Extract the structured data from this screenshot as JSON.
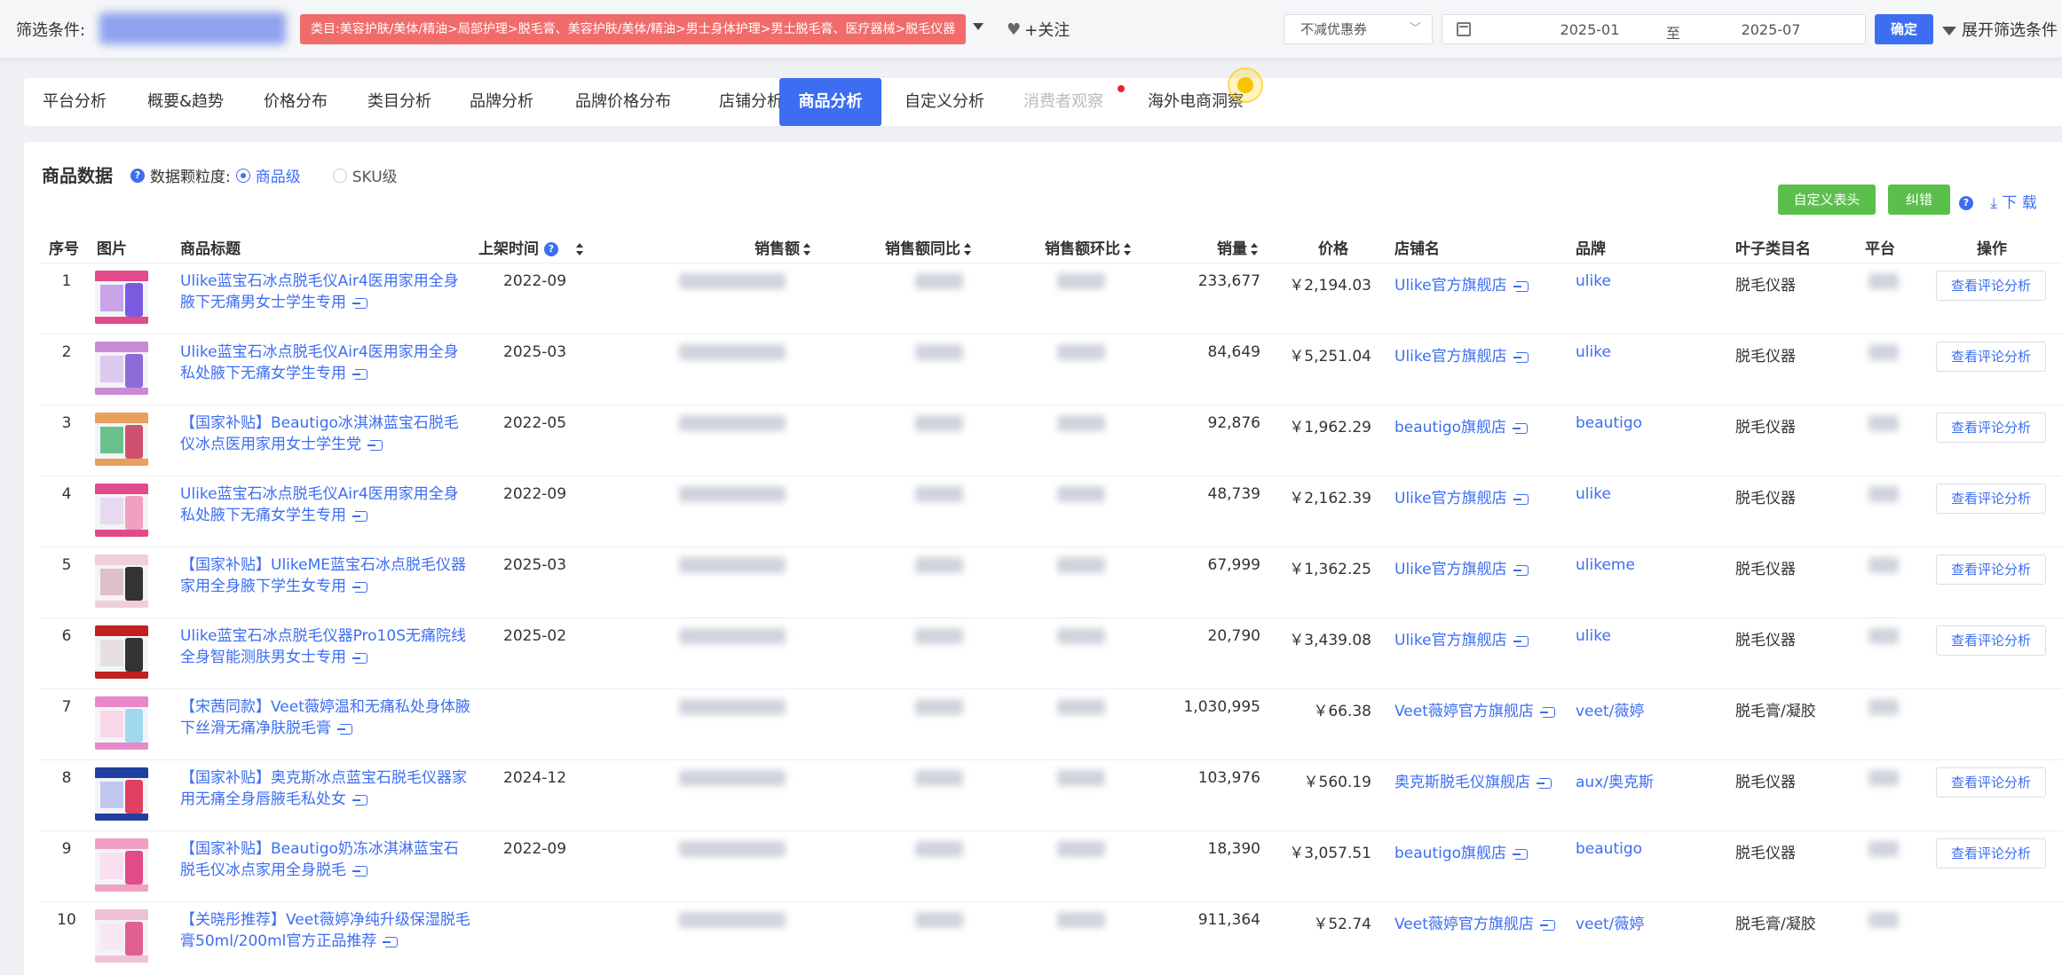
{
  "filter": {
    "label": "筛选条件:",
    "category": "类目:美容护肤/美体/精油>局部护理>脱毛膏、美容护肤/美体/精油>男士身体护理>男士脱毛膏、医疗器械>脱毛仪器",
    "follow": "+关注",
    "discount_select": "不减优惠券",
    "date_from": "2025-01",
    "date_to_label": "至",
    "date_to": "2025-07",
    "confirm": "确定",
    "expand": "展开筛选条件"
  },
  "tabs": [
    {
      "label": "平台分析",
      "state": "normal"
    },
    {
      "label": "概要&趋势",
      "state": "normal"
    },
    {
      "label": "价格分布",
      "state": "normal"
    },
    {
      "label": "类目分析",
      "state": "normal"
    },
    {
      "label": "品牌分析",
      "state": "normal"
    },
    {
      "label": "品牌价格分布",
      "state": "normal"
    },
    {
      "label": "店铺分析",
      "state": "normal"
    },
    {
      "label": "商品分析",
      "state": "active"
    },
    {
      "label": "自定义分析",
      "state": "normal"
    },
    {
      "label": "消费者观察",
      "state": "disabled"
    },
    {
      "label": "海外电商洞察",
      "state": "normal"
    }
  ],
  "section": {
    "title": "商品数据",
    "granularity_label": "数据颗粒度:",
    "option_item": "商品级",
    "option_sku": "SKU级",
    "custom_header_btn": "自定义表头",
    "correct_btn": "纠错",
    "download": "下 载"
  },
  "columns": {
    "idx": "序号",
    "img": "图片",
    "title": "商品标题",
    "listed": "上架时间",
    "sales": "销售额",
    "yoy": "销售额同比",
    "mom": "销售额环比",
    "volume": "销量",
    "price": "价格",
    "shop": "店铺名",
    "brand": "品牌",
    "leaf": "叶子类目名",
    "platform": "平台",
    "op": "操作"
  },
  "op_label": "查看评论分析",
  "rows": [
    {
      "idx": "1",
      "title": "Ulike蓝宝石冰点脱毛仪Air4医用家用全身腋下无痛男女士学生专用",
      "listed": "2022-09",
      "volume": "233,677",
      "price": "￥2,194.03",
      "shop": "Ulike官方旗舰店",
      "brand": "ulike",
      "leaf": "脱毛仪器",
      "op": true
    },
    {
      "idx": "2",
      "title": "Ulike蓝宝石冰点脱毛仪Air4医用家用全身私处腋下无痛女学生专用",
      "listed": "2025-03",
      "volume": "84,649",
      "price": "￥5,251.04",
      "shop": "Ulike官方旗舰店",
      "brand": "ulike",
      "leaf": "脱毛仪器",
      "op": true
    },
    {
      "idx": "3",
      "title": "【国家补贴】Beautigo冰淇淋蓝宝石脱毛仪冰点医用家用女士学生党",
      "listed": "2022-05",
      "volume": "92,876",
      "price": "￥1,962.29",
      "shop": "beautigo旗舰店",
      "brand": "beautigo",
      "leaf": "脱毛仪器",
      "op": true
    },
    {
      "idx": "4",
      "title": "Ulike蓝宝石冰点脱毛仪Air4医用家用全身私处腋下无痛女学生专用",
      "listed": "2022-09",
      "volume": "48,739",
      "price": "￥2,162.39",
      "shop": "Ulike官方旗舰店",
      "brand": "ulike",
      "leaf": "脱毛仪器",
      "op": true
    },
    {
      "idx": "5",
      "title": "【国家补贴】UlikeME蓝宝石冰点脱毛仪器家用全身腋下学生女专用",
      "listed": "2025-03",
      "volume": "67,999",
      "price": "￥1,362.25",
      "shop": "Ulike官方旗舰店",
      "brand": "ulikeme",
      "leaf": "脱毛仪器",
      "op": true
    },
    {
      "idx": "6",
      "title": "Ulike蓝宝石冰点脱毛仪器Pro10S无痛院线全身智能测肤男女士专用",
      "listed": "2025-02",
      "volume": "20,790",
      "price": "￥3,439.08",
      "shop": "Ulike官方旗舰店",
      "brand": "ulike",
      "leaf": "脱毛仪器",
      "op": true
    },
    {
      "idx": "7",
      "title": "【宋茜同款】Veet薇婷温和无痛私处身体腋下丝滑无痛净肤脱毛膏",
      "listed": "",
      "volume": "1,030,995",
      "price": "￥66.38",
      "shop": "Veet薇婷官方旗舰店",
      "brand": "veet/薇婷",
      "leaf": "脱毛膏/凝胶",
      "op": false
    },
    {
      "idx": "8",
      "title": "【国家补贴】奥克斯冰点蓝宝石脱毛仪器家用无痛全身唇腋毛私处女",
      "listed": "2024-12",
      "volume": "103,976",
      "price": "￥560.19",
      "shop": "奥克斯脱毛仪旗舰店",
      "brand": "aux/奥克斯",
      "leaf": "脱毛仪器",
      "op": true
    },
    {
      "idx": "9",
      "title": "【国家补贴】Beautigo奶冻冰淇淋蓝宝石脱毛仪冰点家用全身脱毛",
      "listed": "2022-09",
      "volume": "18,390",
      "price": "￥3,057.51",
      "shop": "beautigo旗舰店",
      "brand": "beautigo",
      "leaf": "脱毛仪器",
      "op": true
    },
    {
      "idx": "10",
      "title": "【关晓彤推荐】Veet薇婷净纯升级保湿脱毛膏50ml/200ml官方正品推荐",
      "listed": "",
      "volume": "911,364",
      "price": "￥52.74",
      "shop": "Veet薇婷官方旗舰店",
      "brand": "veet/薇婷",
      "leaf": "脱毛膏/凝胶",
      "op": false
    }
  ],
  "colors": {
    "accent": "#3d6ef2",
    "category_tag": "#f26b6b",
    "green_btn": "#5bbf4c"
  }
}
